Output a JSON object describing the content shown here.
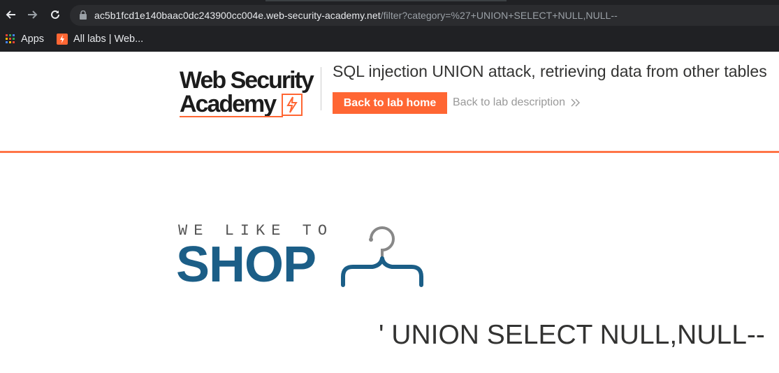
{
  "browser": {
    "url_host": "ac5b1fcd1e140baac0dc243900cc004e.web-security-academy.net",
    "url_path": "/filter?category=%27+UNION+SELECT+NULL,NULL--",
    "bookmarks": [
      {
        "label": "Apps",
        "icon": "apps-grid-icon"
      },
      {
        "label": "All labs | Web...",
        "icon": "portswigger-icon"
      }
    ]
  },
  "lab": {
    "logo_line1": "Web Security",
    "logo_line2": "Academy",
    "title": "SQL injection UNION attack, retrieving data from other tables",
    "back_home": "Back to lab home",
    "back_description": "Back to lab description"
  },
  "shop": {
    "tagline": "WE LIKE TO",
    "word": "SHOP",
    "filter_heading": "' UNION SELECT NULL,NULL--"
  },
  "colors": {
    "accent": "#ff6633",
    "shop_blue": "#1b5e87",
    "chrome_bg": "#202124"
  }
}
